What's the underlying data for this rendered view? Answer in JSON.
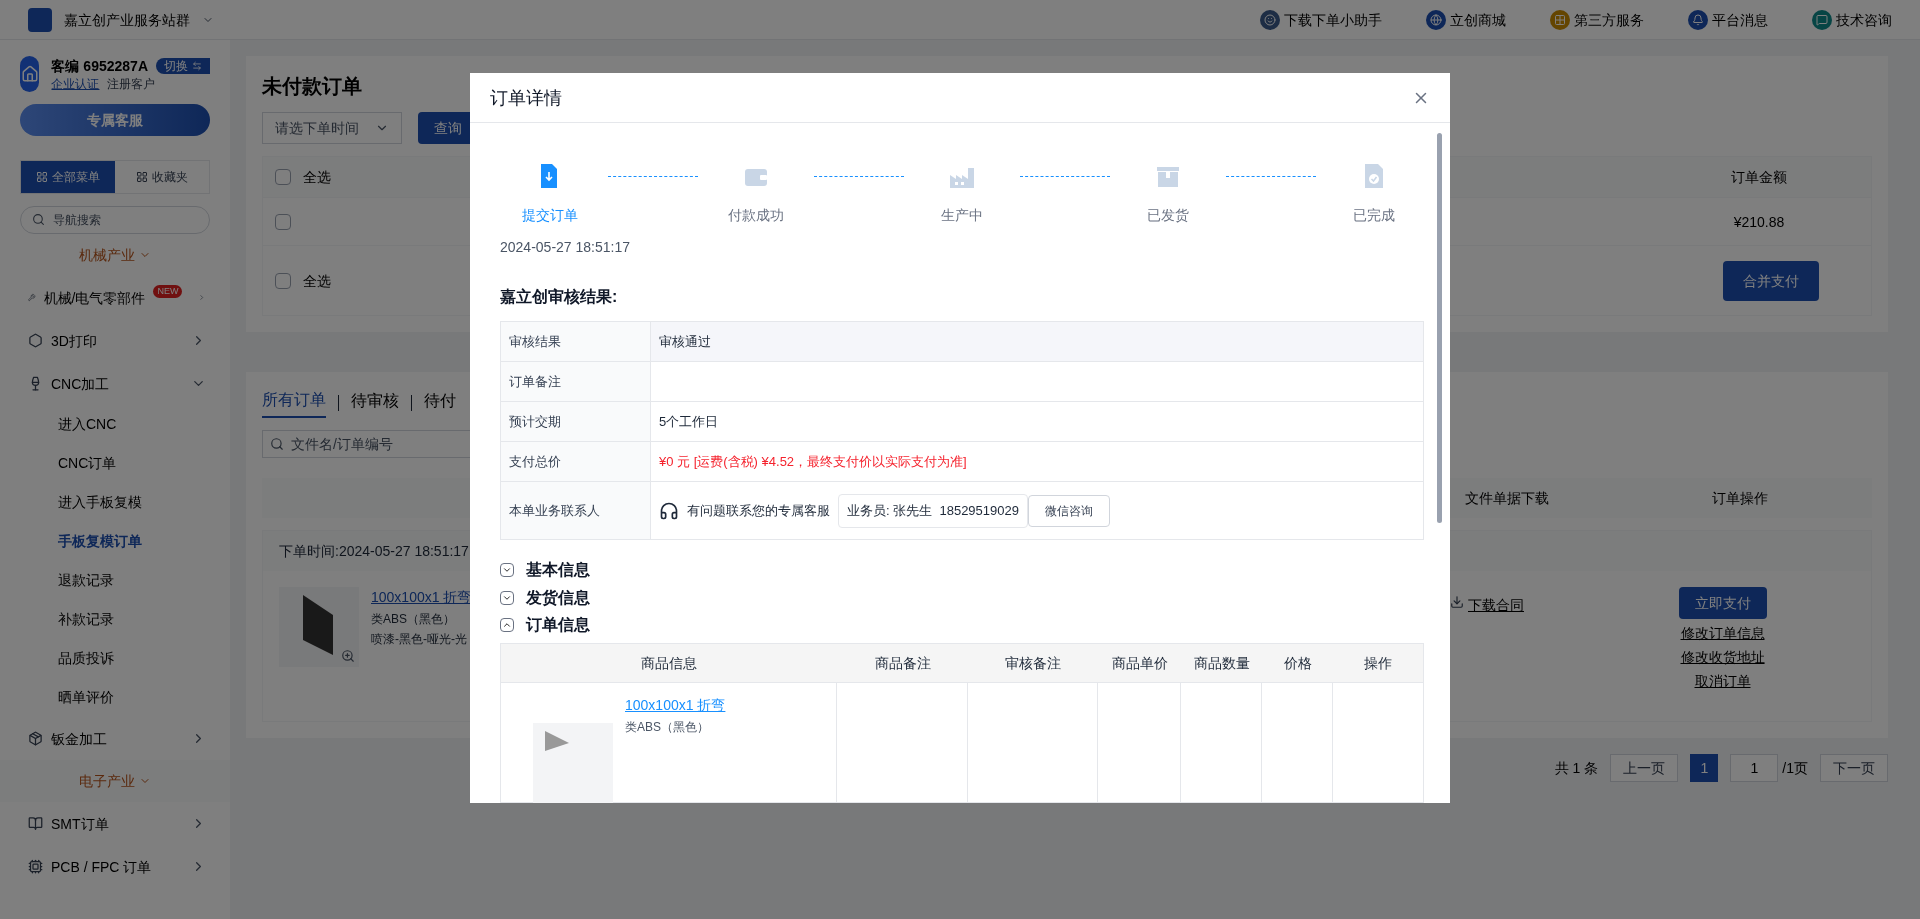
{
  "top_bar": {
    "site_name": "嘉立创产业服务站群",
    "links": [
      {
        "label": "下载下单小助手"
      },
      {
        "label": "立创商城"
      },
      {
        "label": "第三方服务"
      },
      {
        "label": "平台消息"
      },
      {
        "label": "技术咨询"
      }
    ]
  },
  "sidebar": {
    "customer_id": "客编 6952287A",
    "switch_badge": "切换",
    "cert_link": "企业认证",
    "customer_type": "注册客户",
    "service_button": "专属客服",
    "menu_tabs": [
      {
        "label": "全部菜单",
        "selected": true
      },
      {
        "label": "收藏夹",
        "selected": false
      }
    ],
    "search": {
      "placeholder": "导航搜索"
    },
    "groups": [
      {
        "title": "机械产业",
        "items": [
          {
            "label": "机械/电气零部件",
            "badge": "NEW",
            "expanded": false
          },
          {
            "label": "3D打印",
            "expanded": false
          },
          {
            "label": "CNC加工",
            "expanded": true,
            "children": [
              {
                "label": "进入CNC",
                "selected": false
              },
              {
                "label": "CNC订单",
                "selected": false
              },
              {
                "label": "进入手板复模",
                "selected": false
              },
              {
                "label": "手板复模订单",
                "selected": true
              },
              {
                "label": "退款记录",
                "selected": false
              },
              {
                "label": "补款记录",
                "selected": false
              },
              {
                "label": "品质投诉",
                "selected": false
              },
              {
                "label": "晒单评价",
                "selected": false
              }
            ]
          },
          {
            "label": "钣金加工",
            "expanded": false
          }
        ]
      },
      {
        "title": "电子产业",
        "items": [
          {
            "label": "SMT订单",
            "expanded": false
          },
          {
            "label": "PCB / FPC 订单",
            "expanded": false
          }
        ]
      }
    ]
  },
  "main": {
    "title": "未付款订单",
    "date_filter": {
      "placeholder": "请选下单时间"
    },
    "query_button": "查询",
    "pay_table": {
      "select_all": "全选",
      "select_all_checked": false,
      "amount_column": "订单金额",
      "rows": [
        {
          "checked": false,
          "amount": "¥210.88"
        }
      ],
      "footer_select_all": "全选",
      "footer_select_all_checked": false,
      "merge_pay_button": "合并支付"
    },
    "order_tabs": [
      {
        "label": "所有订单",
        "selected": true
      },
      {
        "label": "待审核",
        "selected": false
      },
      {
        "label": "待付",
        "selected": false
      }
    ],
    "search": {
      "placeholder": "文件名/订单编号"
    },
    "order_columns": [
      "文件单据下载",
      "订单操作"
    ],
    "order": {
      "time": "下单时间:2024-05-27 18:51:17",
      "name": "100x100x1 折弯",
      "material": "类ABS（黑色）",
      "finish": "喷漆-黑色-哑光-光",
      "download": "下载合同",
      "pay_button": "立即支付",
      "actions": [
        "修改订单信息",
        "修改收货地址",
        "取消订单"
      ]
    },
    "pagination": {
      "total": "共 1 条",
      "prev": "上一页",
      "pages": [
        {
          "label": "1",
          "selected": true
        }
      ],
      "page_input": "1",
      "page_total": "/1页",
      "next": "下一页"
    }
  },
  "modal": {
    "title": "订单详情",
    "steps": [
      {
        "label": "提交订单",
        "done": true
      },
      {
        "label": "付款成功",
        "done": false
      },
      {
        "label": "生产中",
        "done": false
      },
      {
        "label": "已发货",
        "done": false
      },
      {
        "label": "已完成",
        "done": false
      }
    ],
    "step_time": "2024-05-27 18:51:17",
    "review_title": "嘉立创审核结果:",
    "review_rows": [
      {
        "kind": "text",
        "label": "审核结果",
        "value": "审核通过"
      },
      {
        "kind": "text",
        "label": "订单备注",
        "value": ""
      },
      {
        "kind": "text",
        "label": "预计交期",
        "value": "5个工作日"
      },
      {
        "kind": "price",
        "label": "支付总价",
        "value": "¥0 元 [运费(含税) ¥4.52，最终支付价以实际支付为准]"
      },
      {
        "kind": "contact",
        "label": "本单业务联系人",
        "hint": "有问题联系您的专属客服",
        "salesperson": "业务员: 张先生  18529519029",
        "wechat_button": "微信咨询"
      }
    ],
    "sections": [
      {
        "title": "基本信息",
        "expanded": false
      },
      {
        "title": "发货信息",
        "expanded": false
      },
      {
        "title": "订单信息",
        "expanded": true
      }
    ],
    "order_table": {
      "columns": [
        "商品信息",
        "商品备注",
        "审核备注",
        "商品单价",
        "商品数量",
        "价格",
        "操作"
      ],
      "rows": [
        {
          "name": "100x100x1 折弯",
          "material": "类ABS（黑色）"
        }
      ]
    }
  }
}
